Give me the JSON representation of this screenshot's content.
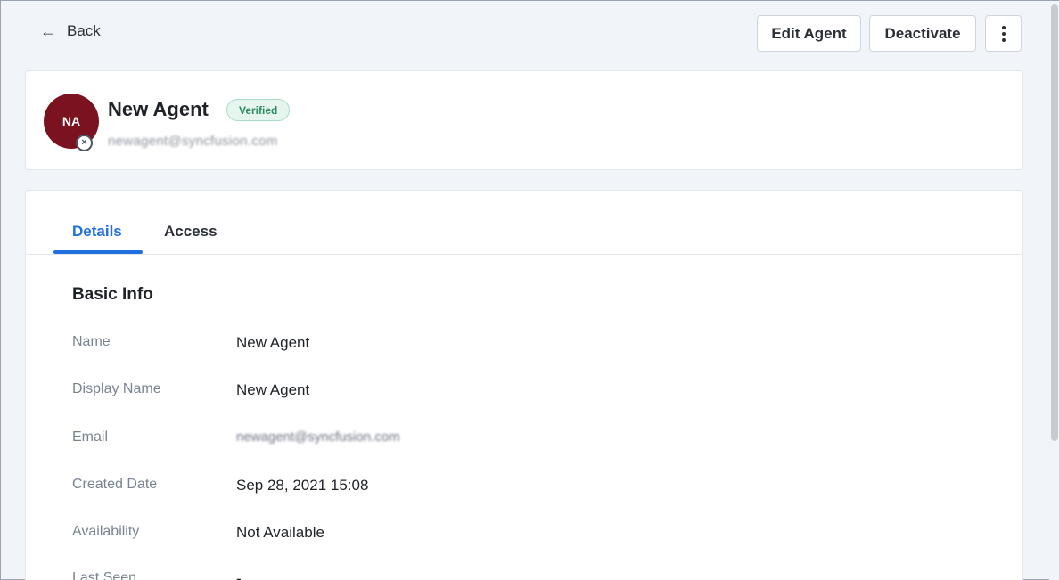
{
  "header": {
    "back_label": "Back",
    "edit_label": "Edit Agent",
    "deactivate_label": "Deactivate"
  },
  "profile": {
    "initials": "NA",
    "name": "New Agent",
    "badge": "Verified",
    "email": "newagent@syncfusion.com",
    "avatar_color": "#7a1220"
  },
  "tabs": [
    {
      "label": "Details",
      "active": true
    },
    {
      "label": "Access",
      "active": false
    }
  ],
  "section": {
    "title": "Basic Info",
    "rows": [
      {
        "label": "Name",
        "value": "New Agent"
      },
      {
        "label": "Display Name",
        "value": "New Agent"
      },
      {
        "label": "Email",
        "value": "newagent@syncfusion.com"
      },
      {
        "label": "Created Date",
        "value": "Sep 28, 2021 15:08"
      },
      {
        "label": "Availability",
        "value": "Not Available"
      },
      {
        "label": "Last Seen",
        "value": "-"
      }
    ]
  },
  "colors": {
    "accent": "#1f6fe0",
    "verified_bg": "#e6f6ef",
    "verified_text": "#2b8a5e"
  }
}
